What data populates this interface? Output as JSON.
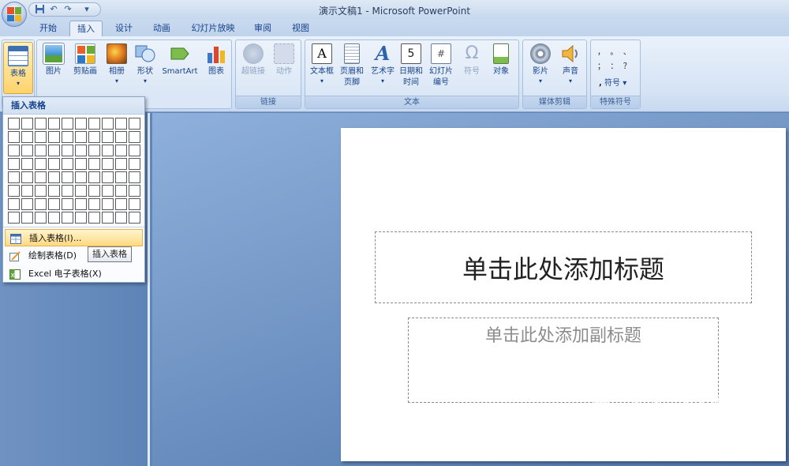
{
  "window": {
    "title": "演示文稿1 - Microsoft PowerPoint"
  },
  "quick_access": {
    "undo_icon": "undo-icon",
    "redo_icon": "redo-icon",
    "save_icon": "save-icon",
    "more": "▾"
  },
  "tabs": [
    {
      "label": "开始"
    },
    {
      "label": "插入"
    },
    {
      "label": "设计"
    },
    {
      "label": "动画"
    },
    {
      "label": "幻灯片放映"
    },
    {
      "label": "审阅"
    },
    {
      "label": "视图"
    }
  ],
  "ribbon": {
    "table": {
      "label": "表格"
    },
    "illustrations": {
      "picture": "图片",
      "clipart": "剪贴画",
      "album": "相册",
      "shapes": "形状",
      "smartart": "SmartArt",
      "chart": "图表"
    },
    "links": {
      "group": "链接",
      "hyperlink": "超链接",
      "action": "动作"
    },
    "text": {
      "group": "文本",
      "textbox": "文本框",
      "header_footer_1": "页眉和",
      "header_footer_2": "页脚",
      "wordart": "艺术字",
      "datetime_1": "日期和",
      "datetime_2": "时间",
      "slide_number_1": "幻灯片",
      "slide_number_2": "编号",
      "symbol": "符号",
      "object": "对象"
    },
    "media": {
      "group": "媒体剪辑",
      "movie": "影片",
      "sound": "声音"
    },
    "special": {
      "group": "特殊符号",
      "symbols_row1": "，  。  、",
      "symbols_row2": "；  ：  ？",
      "symbol_label": "符号"
    }
  },
  "dropdown": {
    "header": "插入表格",
    "items": [
      {
        "label": "插入表格(I)..."
      },
      {
        "label": "绘制表格(D)"
      },
      {
        "label": "Excel 电子表格(X)"
      }
    ],
    "tooltip": "插入表格"
  },
  "slide": {
    "title_placeholder": "单击此处添加标题",
    "subtitle_placeholder": "单击此处添加副标题"
  },
  "watermark": {
    "brand": "Baidu经验",
    "url": "jingyan.baidu.com"
  },
  "colors": {
    "ribbon": "#dbe7f6",
    "accent": "#ffd36b",
    "text": "#15428b"
  }
}
